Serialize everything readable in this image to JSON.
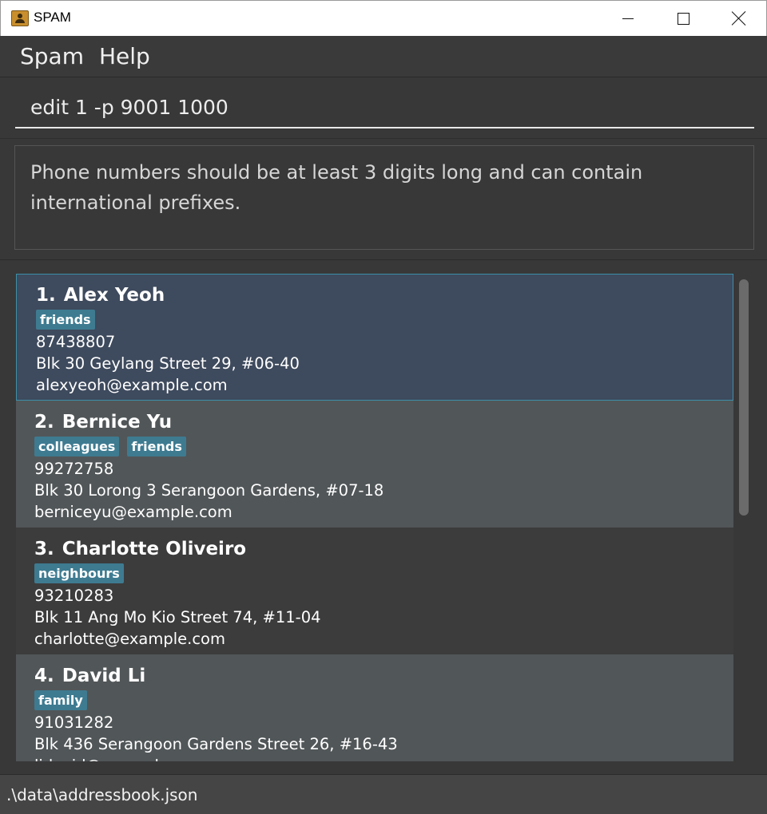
{
  "window": {
    "title": "SPAM"
  },
  "menu": {
    "items": [
      "Spam",
      "Help"
    ]
  },
  "command": {
    "value": "edit 1 -p 9001 1000",
    "placeholder": ""
  },
  "result": {
    "message": "Phone numbers should be at least 3 digits long and can contain international prefixes."
  },
  "persons": [
    {
      "index": "1.",
      "name": "Alex Yeoh",
      "tags": [
        "friends"
      ],
      "phone": "87438807",
      "address": "Blk 30 Geylang Street 29, #06-40",
      "email": "alexyeoh@example.com"
    },
    {
      "index": "2.",
      "name": "Bernice Yu",
      "tags": [
        "colleagues",
        "friends"
      ],
      "phone": "99272758",
      "address": "Blk 30 Lorong 3 Serangoon Gardens, #07-18",
      "email": "berniceyu@example.com"
    },
    {
      "index": "3.",
      "name": "Charlotte Oliveiro",
      "tags": [
        "neighbours"
      ],
      "phone": "93210283",
      "address": "Blk 11 Ang Mo Kio Street 74, #11-04",
      "email": "charlotte@example.com"
    },
    {
      "index": "4.",
      "name": "David Li",
      "tags": [
        "family"
      ],
      "phone": "91031282",
      "address": "Blk 436 Serangoon Gardens Street 26, #16-43",
      "email": "lidavid@example.com"
    }
  ],
  "selected_index": 0,
  "status": {
    "path": ".\\data\\addressbook.json"
  },
  "colors": {
    "background": "#383838",
    "tag": "#3e7b91",
    "selected_card": "#3e4a5d",
    "selected_border": "#3c8fa8"
  }
}
